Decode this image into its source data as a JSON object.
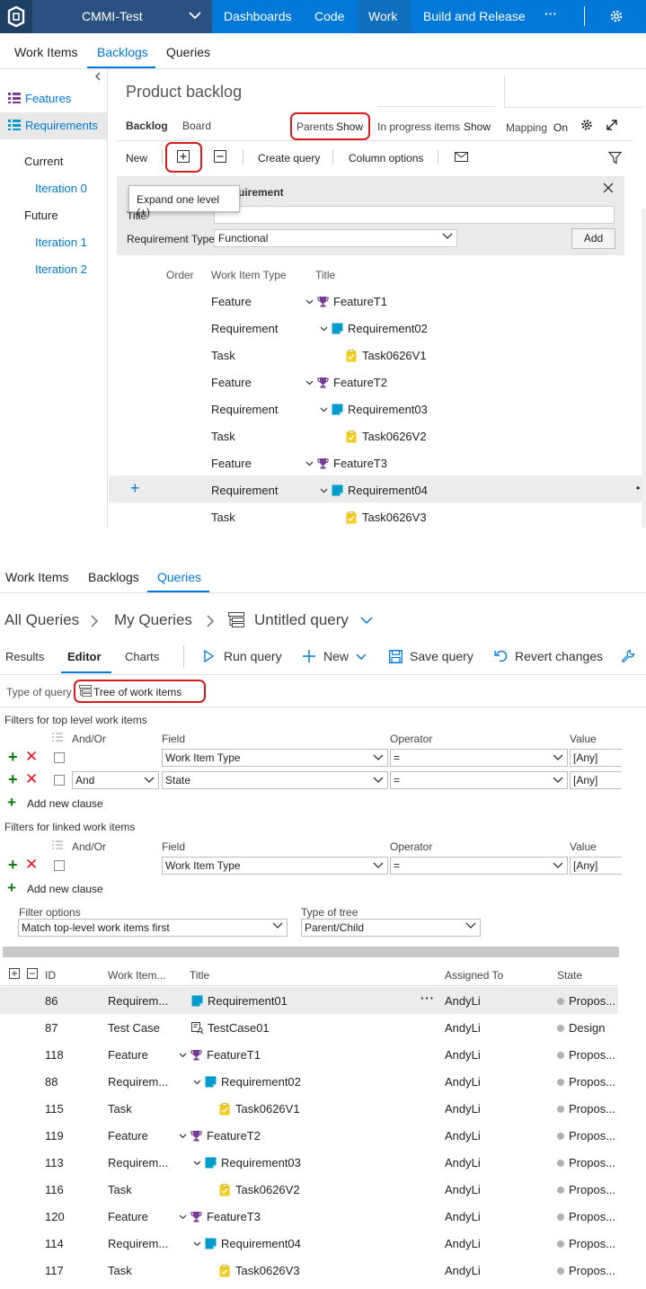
{
  "topnav": {
    "project": "CMMI-Test",
    "items": [
      "Dashboards",
      "Code",
      "Work",
      "Build and Release"
    ],
    "more": "···"
  },
  "subnav": {
    "work_items": "Work Items",
    "backlogs": "Backlogs",
    "queries": "Queries"
  },
  "left_panel": {
    "features": "Features",
    "requirements": "Requirements",
    "current": "Current",
    "iteration0": "Iteration 0",
    "future": "Future",
    "iteration1": "Iteration 1",
    "iteration2": "Iteration 2"
  },
  "backlog": {
    "title": "Product backlog",
    "tab_backlog": "Backlog",
    "tab_board": "Board",
    "parents_label": "Parents",
    "parents_value": "Show",
    "inprogress_label": "In progress items",
    "inprogress_value": "Show",
    "mapping_label": "Mapping",
    "mapping_value": "On",
    "toolbar": {
      "new": "New",
      "create_query": "Create query",
      "column_options": "Column options"
    },
    "tooltip": "Expand one level (+)",
    "new_panel": {
      "header_fragment": "uirement",
      "title_label": "Title",
      "type_label": "Requirement Type",
      "type_value": "Functional",
      "add": "Add"
    },
    "columns": {
      "order": "Order",
      "type": "Work Item Type",
      "title": "Title"
    },
    "rows": [
      {
        "type": "Feature",
        "title": "FeatureT1"
      },
      {
        "type": "Requirement",
        "title": "Requirement02"
      },
      {
        "type": "Task",
        "title": "Task0626V1"
      },
      {
        "type": "Feature",
        "title": "FeatureT2"
      },
      {
        "type": "Requirement",
        "title": "Requirement03"
      },
      {
        "type": "Task",
        "title": "Task0626V2"
      },
      {
        "type": "Feature",
        "title": "FeatureT3"
      },
      {
        "type": "Requirement",
        "title": "Requirement04"
      },
      {
        "type": "Task",
        "title": "Task0626V3"
      }
    ]
  },
  "query": {
    "breadcrumb": {
      "all": "All Queries",
      "my": "My Queries",
      "current": "Untitled query"
    },
    "tabs": {
      "results": "Results",
      "editor": "Editor",
      "charts": "Charts"
    },
    "toolbar": {
      "run": "Run query",
      "new": "New",
      "save": "Save query",
      "revert": "Revert changes"
    },
    "type_of_query_label": "Type of query",
    "type_of_query_value": "Tree of work items",
    "top_filters_label": "Filters for top level work items",
    "linked_filters_label": "Filters for linked work items",
    "col_andor": "And/Or",
    "col_field": "Field",
    "col_operator": "Operator",
    "col_value": "Value",
    "top_clauses": [
      {
        "andor": "",
        "field": "Work Item Type",
        "op": "=",
        "value": "[Any]"
      },
      {
        "andor": "And",
        "field": "State",
        "op": "=",
        "value": "[Any]"
      }
    ],
    "linked_clauses": [
      {
        "andor": "",
        "field": "Work Item Type",
        "op": "=",
        "value": "[Any]"
      }
    ],
    "add_clause": "Add new clause",
    "filter_options_label": "Filter options",
    "filter_options_value": "Match top-level work items first",
    "tree_type_label": "Type of tree",
    "tree_type_value": "Parent/Child",
    "results_columns": {
      "id": "ID",
      "type": "Work Item...",
      "title": "Title",
      "assigned": "Assigned To",
      "state": "State"
    },
    "results": [
      {
        "id": "86",
        "type": "Requirem...",
        "title": "Requirement01",
        "assigned": "AndyLi",
        "state": "Propos..."
      },
      {
        "id": "87",
        "type": "Test Case",
        "title": "TestCase01",
        "assigned": "AndyLi",
        "state": "Design"
      },
      {
        "id": "118",
        "type": "Feature",
        "title": "FeatureT1",
        "assigned": "AndyLi",
        "state": "Propos..."
      },
      {
        "id": "88",
        "type": "Requirem...",
        "title": "Requirement02",
        "assigned": "AndyLi",
        "state": "Propos..."
      },
      {
        "id": "115",
        "type": "Task",
        "title": "Task0626V1",
        "assigned": "AndyLi",
        "state": "Propos..."
      },
      {
        "id": "119",
        "type": "Feature",
        "title": "FeatureT2",
        "assigned": "AndyLi",
        "state": "Propos..."
      },
      {
        "id": "113",
        "type": "Requirem...",
        "title": "Requirement03",
        "assigned": "AndyLi",
        "state": "Propos..."
      },
      {
        "id": "116",
        "type": "Task",
        "title": "Task0626V2",
        "assigned": "AndyLi",
        "state": "Propos..."
      },
      {
        "id": "120",
        "type": "Feature",
        "title": "FeatureT3",
        "assigned": "AndyLi",
        "state": "Propos..."
      },
      {
        "id": "114",
        "type": "Requirem...",
        "title": "Requirement04",
        "assigned": "AndyLi",
        "state": "Propos..."
      },
      {
        "id": "117",
        "type": "Task",
        "title": "Task0626V3",
        "assigned": "AndyLi",
        "state": "Propos..."
      }
    ]
  },
  "colors": {
    "accent": "#0078d7",
    "feature": "#773b93",
    "requirement": "#009ccc",
    "task": "#f2cb1d",
    "highlight": "#d61c1c"
  }
}
